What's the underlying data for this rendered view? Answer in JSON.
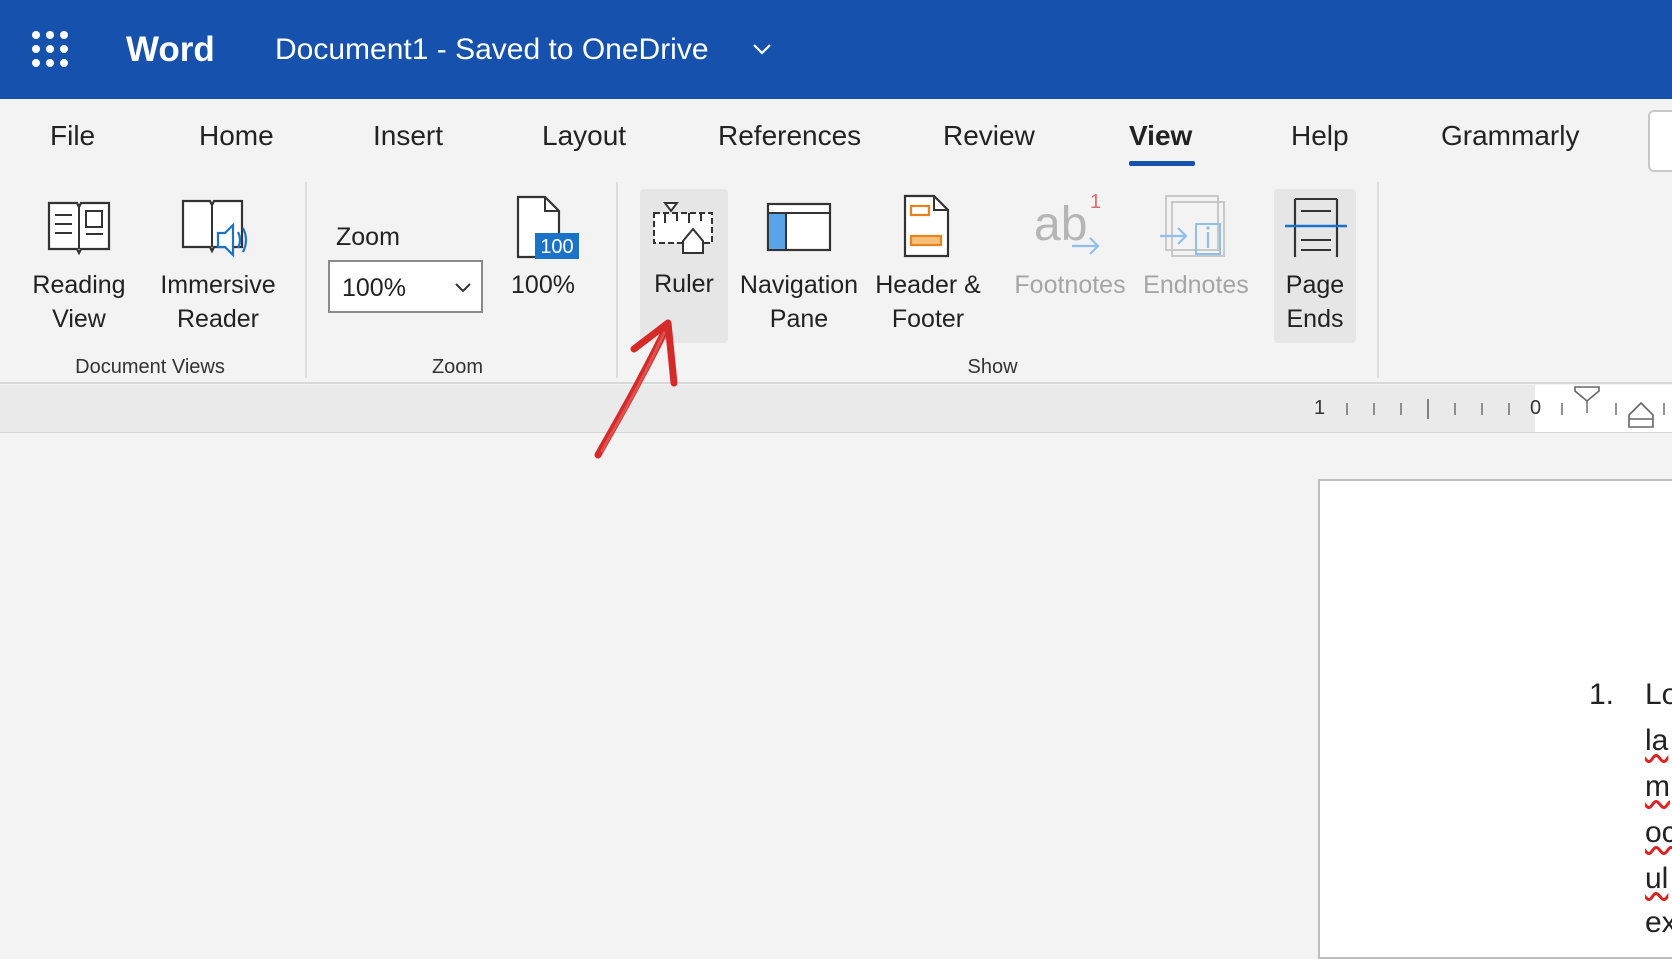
{
  "app": {
    "name": "Word",
    "document_title": "Document1  -  Saved to OneDrive"
  },
  "tabs": [
    {
      "label": "File"
    },
    {
      "label": "Home"
    },
    {
      "label": "Insert"
    },
    {
      "label": "Layout"
    },
    {
      "label": "References"
    },
    {
      "label": "Review"
    },
    {
      "label": "View"
    },
    {
      "label": "Help"
    },
    {
      "label": "Grammarly"
    }
  ],
  "active_tab": "View",
  "ribbon": {
    "document_views": {
      "group_label": "Document Views",
      "reading_view": "Reading\nView",
      "immersive_reader": "Immersive\nReader"
    },
    "zoom": {
      "group_label": "Zoom",
      "zoom_label": "Zoom",
      "zoom_value": "100%",
      "zoom_100_label": "100%",
      "zoom_100_icon_text": "100"
    },
    "show": {
      "group_label": "Show",
      "ruler": "Ruler",
      "navigation_pane": "Navigation\nPane",
      "header_footer": "Header &\nFooter",
      "footnotes": "Footnotes",
      "footnotes_superscript": "1",
      "endnotes": "Endnotes",
      "page_ends": "Page\nEnds"
    }
  },
  "ruler": {
    "numbers": [
      "1",
      "0"
    ]
  },
  "document": {
    "list_number": "1.",
    "fragments": [
      "Lo",
      "la",
      "m",
      "oc",
      "ul",
      "ex"
    ]
  },
  "colors": {
    "title_bar": "#1651ad",
    "annotation_arrow": "#d42a2a"
  }
}
